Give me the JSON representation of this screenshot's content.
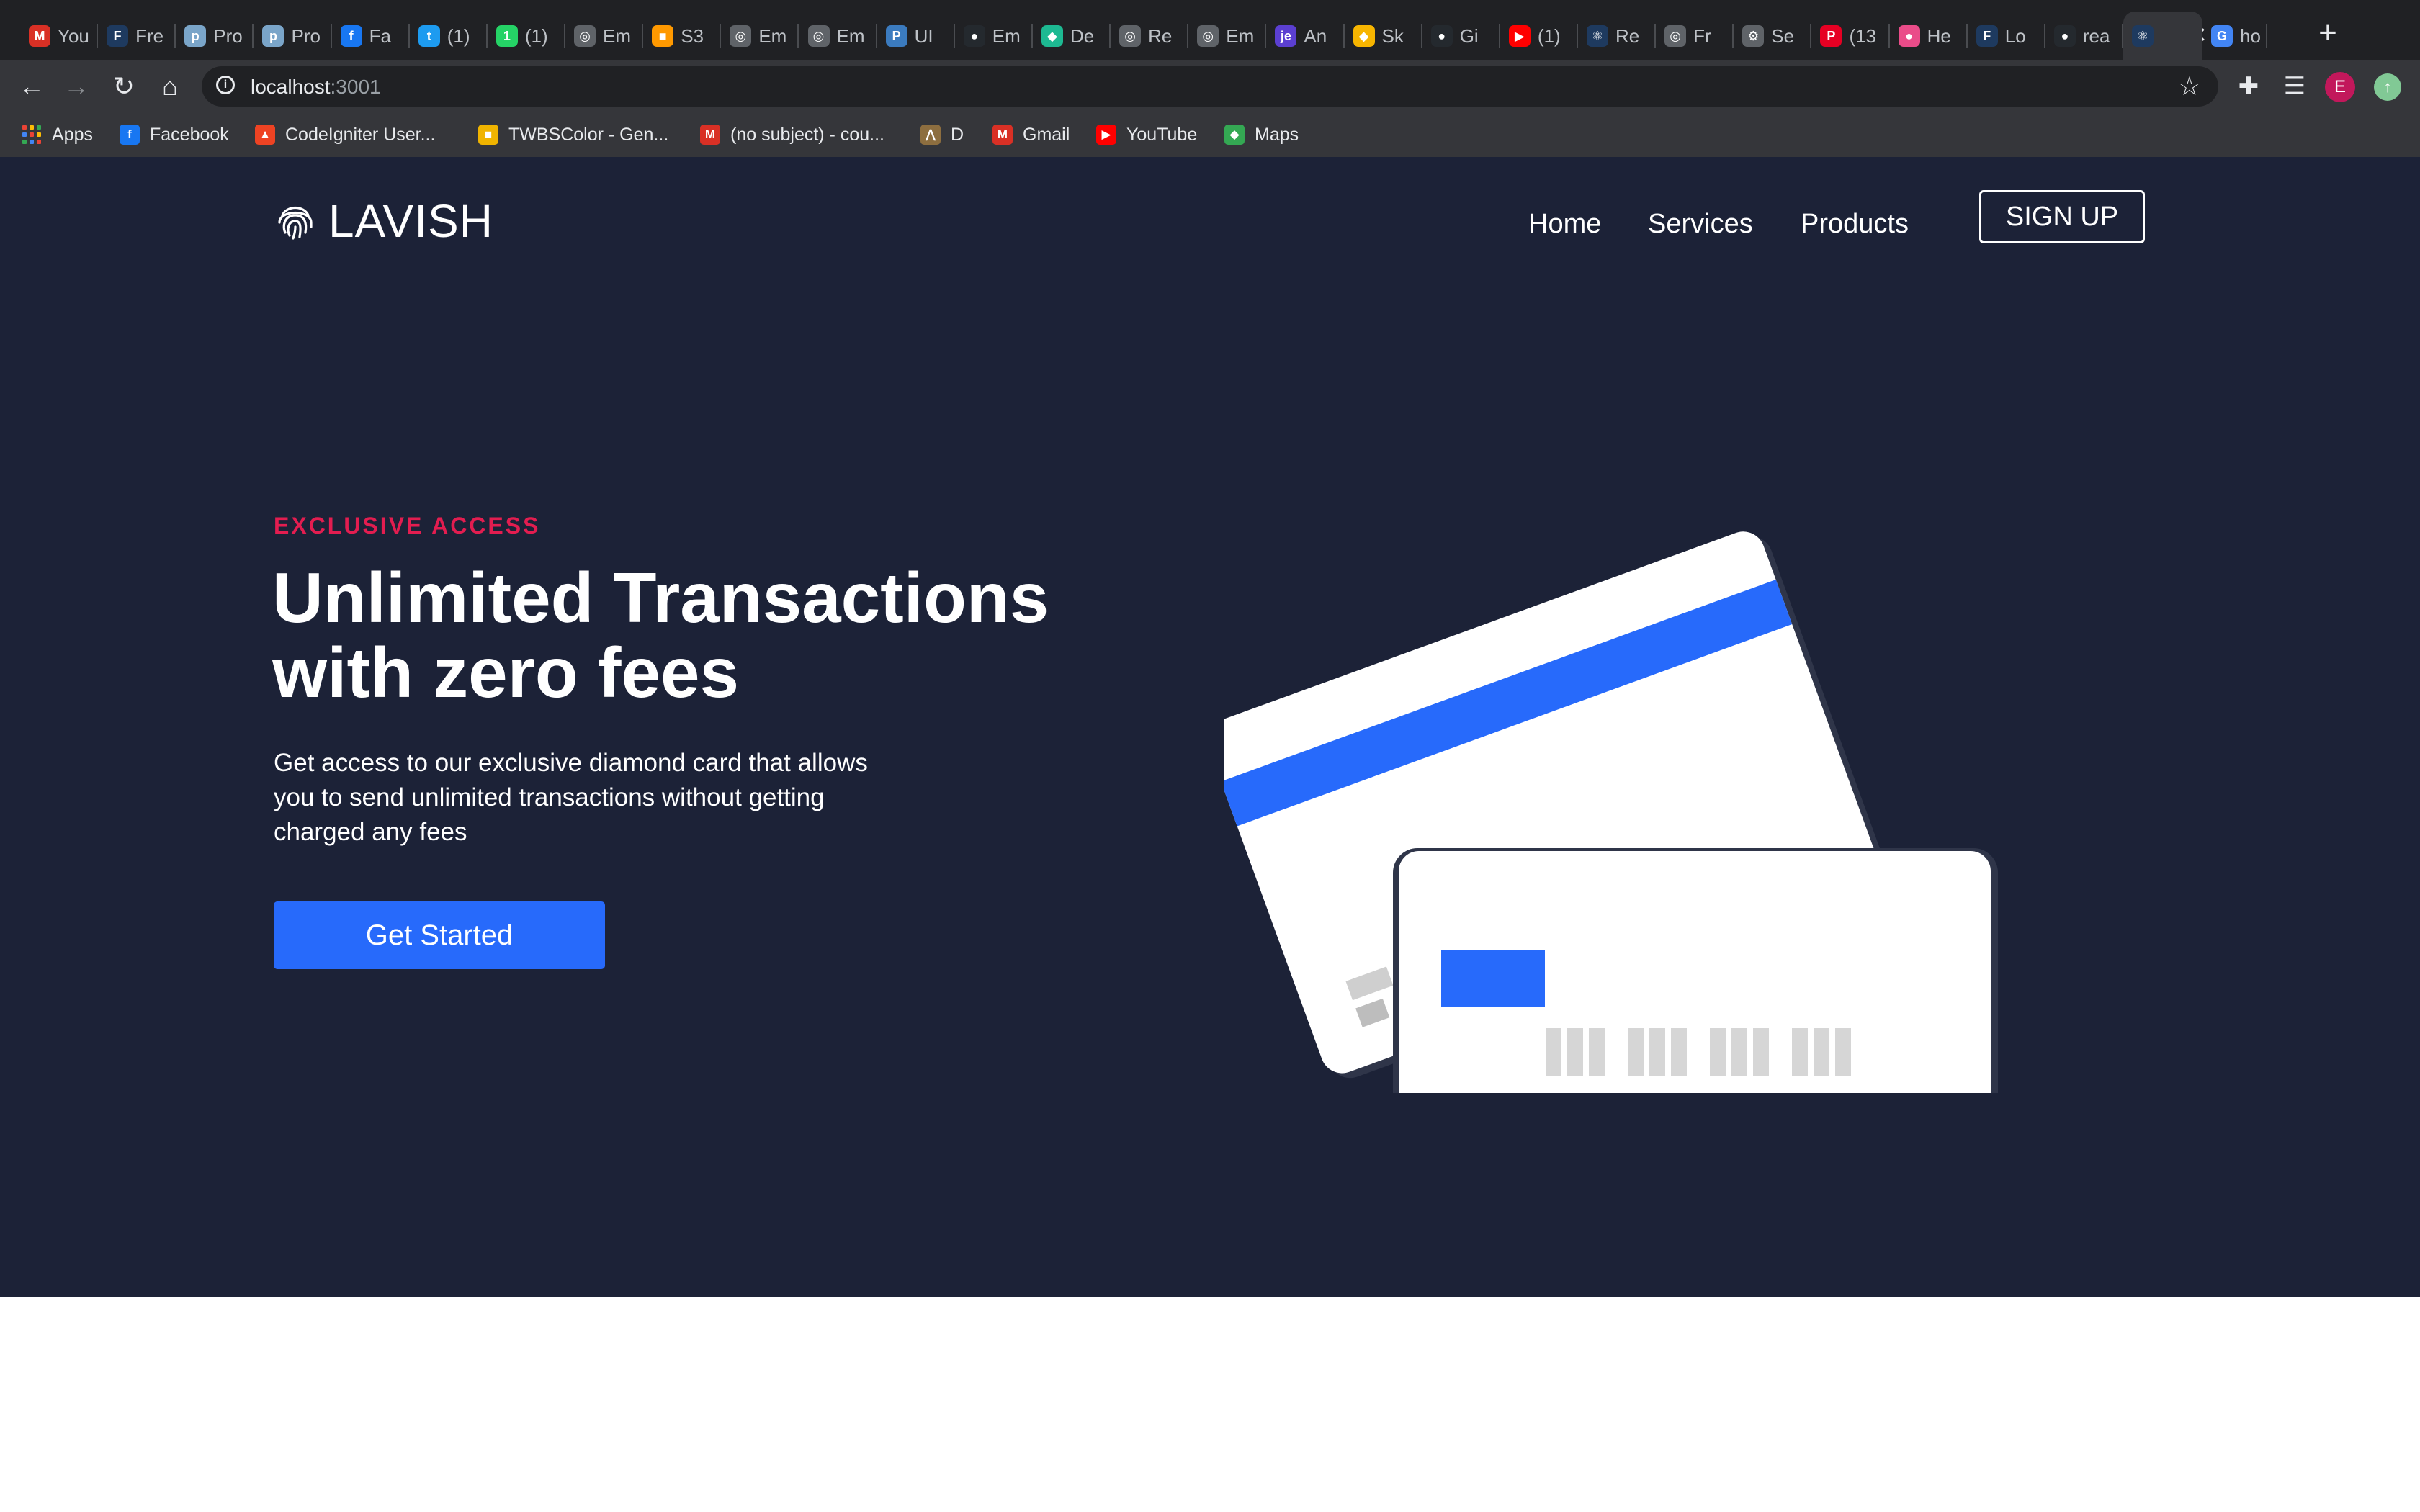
{
  "browser": {
    "tabs": [
      {
        "label": "You",
        "icon": "gmail-icon",
        "color": "#d93025",
        "glyph": "M"
      },
      {
        "label": "Fre",
        "icon": "flo-icon",
        "color": "#1e3a5f",
        "glyph": "F"
      },
      {
        "label": "Pro",
        "icon": "page-icon",
        "color": "#7aa5c9",
        "glyph": "p"
      },
      {
        "label": "Pro",
        "icon": "page-icon",
        "color": "#7aa5c9",
        "glyph": "p"
      },
      {
        "label": "Fa",
        "icon": "facebook-icon",
        "color": "#1877f2",
        "glyph": "f"
      },
      {
        "label": "(1)",
        "icon": "twitter-icon",
        "color": "#1d9bf0",
        "glyph": "t"
      },
      {
        "label": "(1)",
        "icon": "whatsapp-icon",
        "color": "#25d366",
        "glyph": "1"
      },
      {
        "label": "Em",
        "icon": "globe-icon",
        "color": "#5f6368",
        "glyph": "◎"
      },
      {
        "label": "S3",
        "icon": "aws-icon",
        "color": "#ff9900",
        "glyph": "■"
      },
      {
        "label": "Em",
        "icon": "globe-icon",
        "color": "#5f6368",
        "glyph": "◎"
      },
      {
        "label": "Em",
        "icon": "globe-icon",
        "color": "#5f6368",
        "glyph": "◎"
      },
      {
        "label": "UI",
        "icon": "paypal-icon",
        "color": "#3b7bbf",
        "glyph": "P"
      },
      {
        "label": "Em",
        "icon": "github-icon",
        "color": "#24292e",
        "glyph": "●"
      },
      {
        "label": "De",
        "icon": "diamond-icon",
        "color": "#1db992",
        "glyph": "◆"
      },
      {
        "label": "Re",
        "icon": "globe-icon",
        "color": "#5f6368",
        "glyph": "◎"
      },
      {
        "label": "Em",
        "icon": "globe-icon",
        "color": "#5f6368",
        "glyph": "◎"
      },
      {
        "label": "An",
        "icon": "je-icon",
        "color": "#5b3fd1",
        "glyph": "je"
      },
      {
        "label": "Sk",
        "icon": "sketch-icon",
        "color": "#f7b500",
        "glyph": "◆"
      },
      {
        "label": "Gi",
        "icon": "github-icon",
        "color": "#24292e",
        "glyph": "●"
      },
      {
        "label": "(1)",
        "icon": "youtube-icon",
        "color": "#ff0000",
        "glyph": "▶"
      },
      {
        "label": "Re",
        "icon": "react-icon",
        "color": "#1e3a5f",
        "glyph": "⚛"
      },
      {
        "label": "Fr",
        "icon": "globe-icon",
        "color": "#5f6368",
        "glyph": "◎"
      },
      {
        "label": "Se",
        "icon": "gear-icon",
        "color": "#5f6368",
        "glyph": "⚙"
      },
      {
        "label": "(13",
        "icon": "pinterest-icon",
        "color": "#e60023",
        "glyph": "P"
      },
      {
        "label": "He",
        "icon": "dribbble-icon",
        "color": "#ea4c89",
        "glyph": "●"
      },
      {
        "label": "Lo",
        "icon": "flo-icon",
        "color": "#1e3a5f",
        "glyph": "F"
      },
      {
        "label": "rea",
        "icon": "github-icon",
        "color": "#24292e",
        "glyph": "●"
      },
      {
        "label": "",
        "icon": "react-icon",
        "color": "#1e3a5f",
        "glyph": "⚛",
        "active": true
      },
      {
        "label": "ho",
        "icon": "google-icon",
        "color": "#4285f4",
        "glyph": "G"
      }
    ],
    "close_tab": "✕",
    "new_tab": "+",
    "nav": {
      "back": "←",
      "forward": "→",
      "reload": "↻",
      "home": "⌂"
    },
    "address": {
      "host": "localhost",
      "port": ":3001",
      "info": "i",
      "star": "☆"
    },
    "toolbar": {
      "extensions": "✚",
      "reading_list": "☰",
      "profile_initial": "E",
      "update": "↑"
    },
    "bookmarks": [
      {
        "label": "Apps",
        "icon": "apps-icon"
      },
      {
        "label": "Facebook",
        "icon": "facebook-icon",
        "color": "#1877f2",
        "glyph": "f"
      },
      {
        "label": "CodeIgniter User...",
        "icon": "codeigniter-icon",
        "color": "#ee4323",
        "glyph": "▲"
      },
      {
        "label": "TWBSColor - Gen...",
        "icon": "twbscolor-icon",
        "color": "#f0b400",
        "glyph": "■"
      },
      {
        "label": "(no subject) - cou...",
        "icon": "gmail-icon",
        "color": "#d93025",
        "glyph": "M"
      },
      {
        "label": "D",
        "icon": "bridge-icon",
        "color": "#8d6e3f",
        "glyph": "⋀"
      },
      {
        "label": "Gmail",
        "icon": "gmail-icon",
        "color": "#d93025",
        "glyph": "M"
      },
      {
        "label": "YouTube",
        "icon": "youtube-icon",
        "color": "#ff0000",
        "glyph": "▶"
      },
      {
        "label": "Maps",
        "icon": "maps-icon",
        "color": "#34a853",
        "glyph": "◆"
      }
    ]
  },
  "site": {
    "brand": "LAVISH",
    "nav": [
      "Home",
      "Services",
      "Products"
    ],
    "signup": "SIGN UP",
    "hero": {
      "eyebrow": "EXCLUSIVE ACCESS",
      "title_line1": "Unlimited Transactions",
      "title_line2": "with zero fees",
      "description": "Get access to our exclusive diamond card that allows you to send unlimited transactions without getting charged any fees",
      "cta": "Get Started"
    },
    "colors": {
      "background": "#1c2237",
      "accent_blue": "#276afb",
      "eyebrow_red": "#e31d50"
    }
  }
}
